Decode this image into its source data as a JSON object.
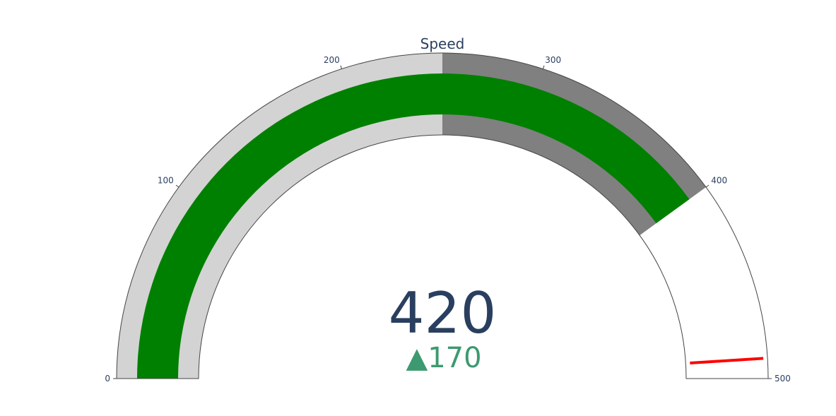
{
  "chart_data": {
    "type": "gauge",
    "title": "Speed",
    "value": 420,
    "delta": {
      "value": 170,
      "symbol": "▲",
      "color": "#3d9970"
    },
    "range": [
      0,
      500
    ],
    "ticks": [
      {
        "value": 0,
        "label": "0"
      },
      {
        "value": 100,
        "label": "100"
      },
      {
        "value": 200,
        "label": "200"
      },
      {
        "value": 300,
        "label": "300"
      },
      {
        "value": 400,
        "label": "400"
      },
      {
        "value": 500,
        "label": "500"
      }
    ],
    "bar": {
      "value": 400,
      "color": "#008000"
    },
    "steps": [
      {
        "range": [
          0,
          250
        ],
        "color": "#d3d3d3"
      },
      {
        "range": [
          250,
          400
        ],
        "color": "#808080"
      }
    ],
    "threshold": {
      "value": 490,
      "color": "#ff0000"
    }
  },
  "colors": {
    "text": "#2a3f5f",
    "outline": "#444444"
  }
}
